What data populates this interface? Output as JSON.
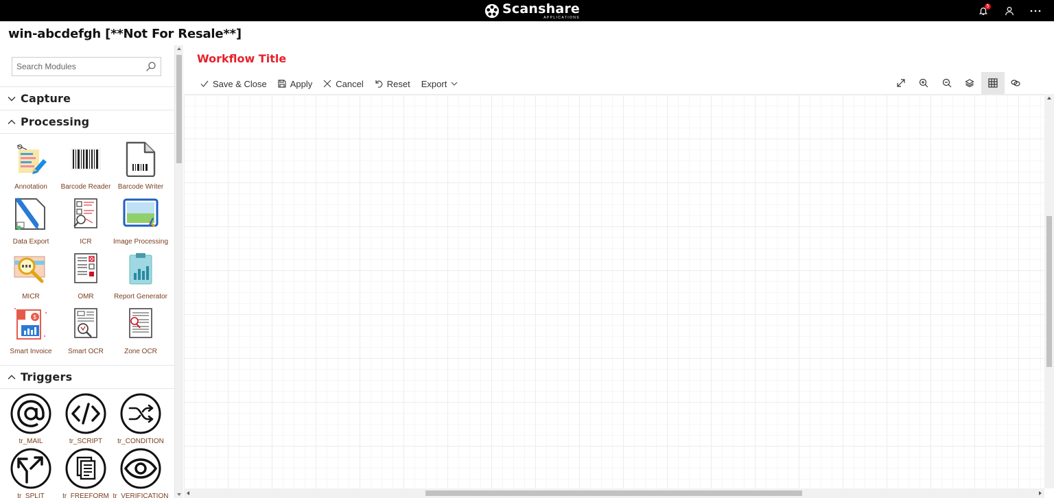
{
  "app": {
    "brand_name": "Scanshare",
    "brand_sub": "APPLICATIONS",
    "notification_count": "5",
    "window_title": "win-abcdefgh [**Not For Resale**]"
  },
  "sidebar": {
    "search_placeholder": "Search Modules",
    "sections": [
      {
        "label": "Capture",
        "expanded": false
      },
      {
        "label": "Processing",
        "expanded": true
      },
      {
        "label": "Triggers",
        "expanded": true
      }
    ],
    "processing_modules": [
      {
        "label": "Annotation",
        "icon": "annotation-icon"
      },
      {
        "label": "Barcode Reader",
        "icon": "barcode-reader-icon"
      },
      {
        "label": "Barcode Writer",
        "icon": "barcode-writer-icon"
      },
      {
        "label": "Data Export",
        "icon": "data-export-icon"
      },
      {
        "label": "ICR",
        "icon": "icr-icon"
      },
      {
        "label": "Image Processing",
        "icon": "image-processing-icon"
      },
      {
        "label": "MICR",
        "icon": "micr-icon"
      },
      {
        "label": "OMR",
        "icon": "omr-icon"
      },
      {
        "label": "Report Generator",
        "icon": "report-generator-icon"
      },
      {
        "label": "Smart Invoice",
        "icon": "smart-invoice-icon"
      },
      {
        "label": "Smart OCR",
        "icon": "smart-ocr-icon"
      },
      {
        "label": "Zone OCR",
        "icon": "zone-ocr-icon"
      }
    ],
    "trigger_modules": [
      {
        "label": "tr_MAIL",
        "icon": "at-sign-icon"
      },
      {
        "label": "tr_SCRIPT",
        "icon": "code-icon"
      },
      {
        "label": "tr_CONDITION",
        "icon": "shuffle-icon"
      },
      {
        "label": "tr_SPLIT",
        "icon": "split-arrows-icon"
      },
      {
        "label": "tr_FREEFORM",
        "icon": "documents-icon"
      },
      {
        "label": "tr_VERIFICATION",
        "icon": "eye-icon"
      }
    ]
  },
  "workflow": {
    "title": "Workflow Title",
    "toolbar": {
      "save_close": "Save & Close",
      "apply": "Apply",
      "cancel": "Cancel",
      "reset": "Reset",
      "export": "Export"
    },
    "view_tools": [
      "fit-icon",
      "zoom-in-icon",
      "zoom-out-icon",
      "layers-icon",
      "grid-icon",
      "link-icon"
    ],
    "active_tool": "grid-icon"
  },
  "colors": {
    "accent_red": "#e8202a",
    "module_label": "#7a3d1d",
    "topbar": "#000000"
  }
}
